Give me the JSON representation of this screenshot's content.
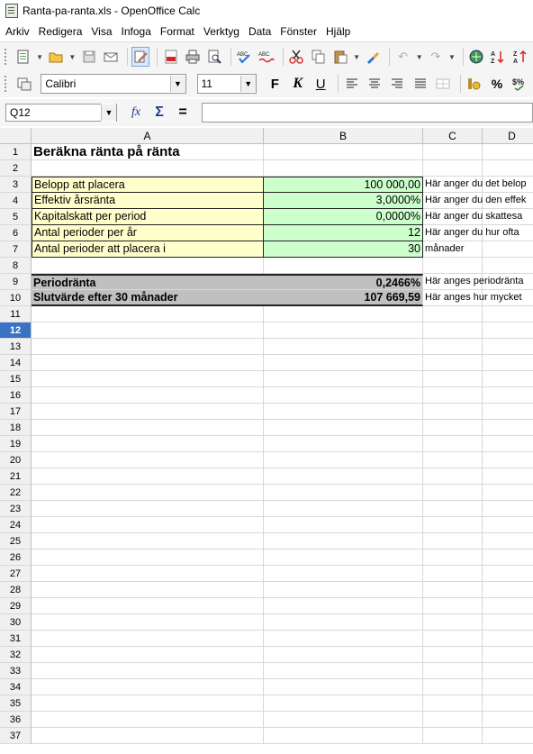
{
  "window": {
    "title": "Ranta-pa-ranta.xls - OpenOffice Calc"
  },
  "menu": [
    "Arkiv",
    "Redigera",
    "Visa",
    "Infoga",
    "Format",
    "Verktyg",
    "Data",
    "Fönster",
    "Hjälp"
  ],
  "format_toolbar": {
    "font_name": "Calibri",
    "font_size": "11",
    "bold": "F",
    "italic": "K",
    "underline": "U"
  },
  "formula_bar": {
    "name_box": "Q12",
    "fx": "fx",
    "sum": "Σ",
    "equals": "=",
    "formula": ""
  },
  "columns": [
    "A",
    "B",
    "C",
    "D"
  ],
  "selected_row": 12,
  "rows": [
    1,
    2,
    3,
    4,
    5,
    6,
    7,
    8,
    9,
    10,
    11,
    12,
    13,
    14,
    15,
    16,
    17,
    18,
    19,
    20,
    21,
    22,
    23,
    24,
    25,
    26,
    27,
    28,
    29,
    30,
    31,
    32,
    33,
    34,
    35,
    36,
    37
  ],
  "sheet": {
    "title": "Beräkna ränta på ränta",
    "inputs": [
      {
        "label": "Belopp att placera",
        "value": "100 000,00",
        "note": "Här anger du det belop"
      },
      {
        "label": "Effektiv årsränta",
        "value": "3,0000%",
        "note": "Här anger du den effek"
      },
      {
        "label": "Kapitalskatt per period",
        "value": "0,0000%",
        "note": "Här anger du skattesa"
      },
      {
        "label": "Antal perioder per år",
        "value": "12",
        "note": "Här anger du hur ofta"
      },
      {
        "label": "Antal perioder att placera i",
        "value": "30",
        "note": "månader"
      }
    ],
    "results": [
      {
        "label": "Periodränta",
        "value": "0,2466%",
        "note": "Här anges periodränta"
      },
      {
        "label": "Slutvärde efter 30 månader",
        "value": "107 669,59",
        "note": "Här anges hur mycket"
      }
    ]
  }
}
